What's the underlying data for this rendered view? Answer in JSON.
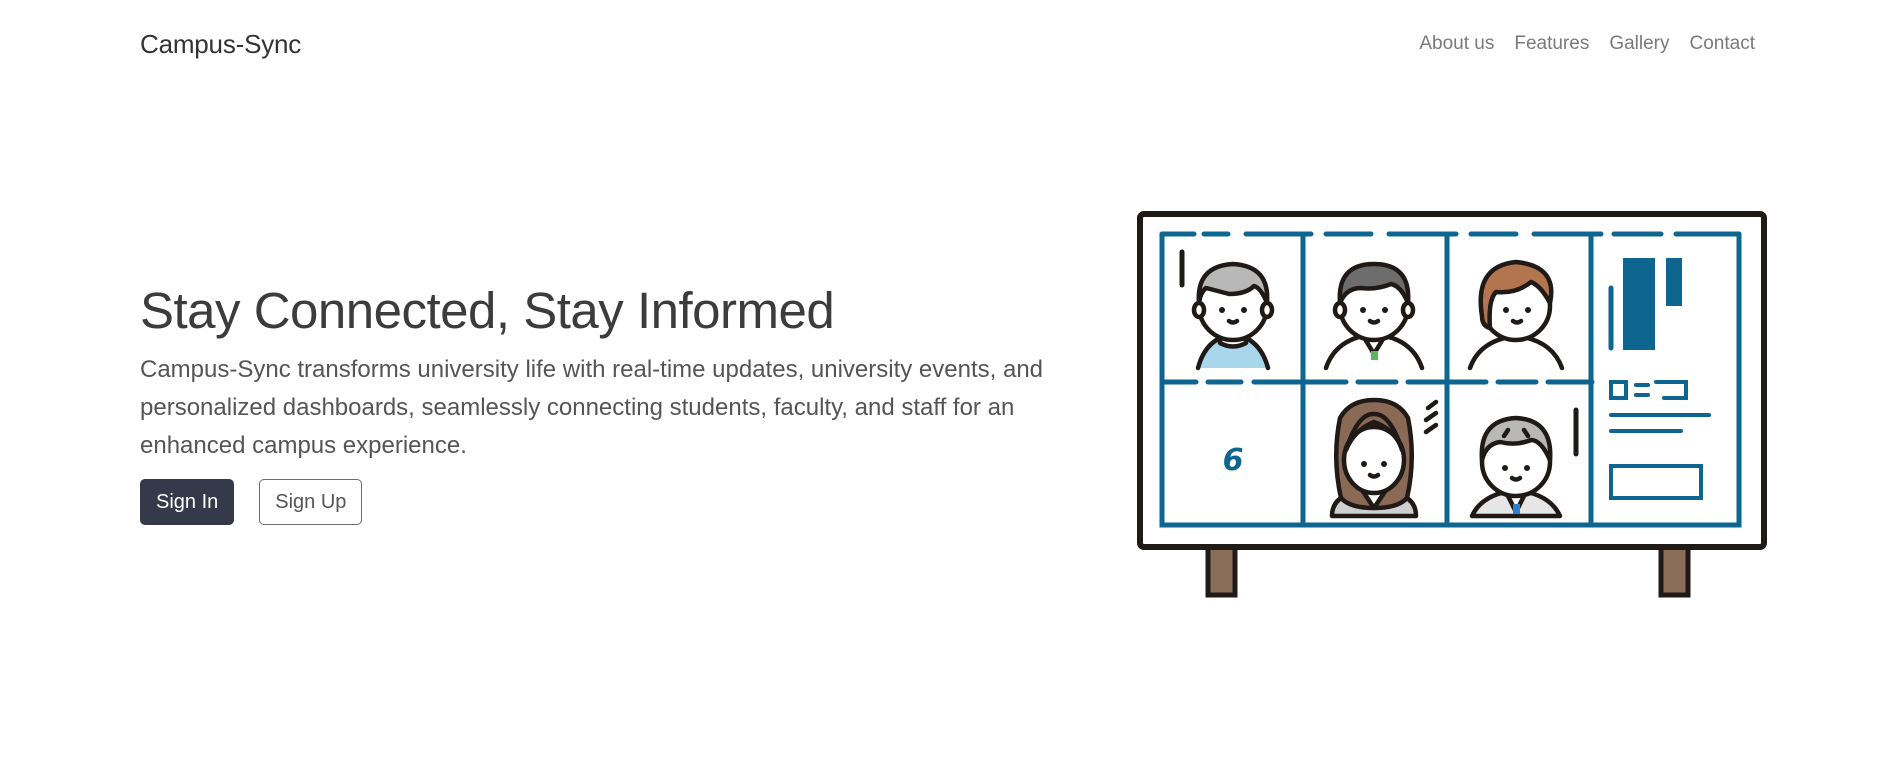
{
  "navbar": {
    "brand": "Campus-Sync",
    "links": [
      "About us",
      "Features",
      "Gallery",
      "Contact"
    ]
  },
  "hero": {
    "title": "Stay Connected, Stay Informed",
    "description": "Campus-Sync transforms university life with real-time updates, university events, and personalized dashboards, seamlessly connecting students, faculty, and staff for an enhanced campus experience.",
    "sign_in_label": "Sign In",
    "sign_up_label": "Sign Up"
  },
  "illustration": {
    "calendar_digit": "6",
    "colors": {
      "frame": "#1f1a17",
      "grid": "#0e6690",
      "leg": "#8a6e5a",
      "hair_gray": "#b8b8b8",
      "hair_dark": "#6d6d6d",
      "hair_brown": "#b2754e",
      "hair_long": "#8b6a55"
    }
  }
}
